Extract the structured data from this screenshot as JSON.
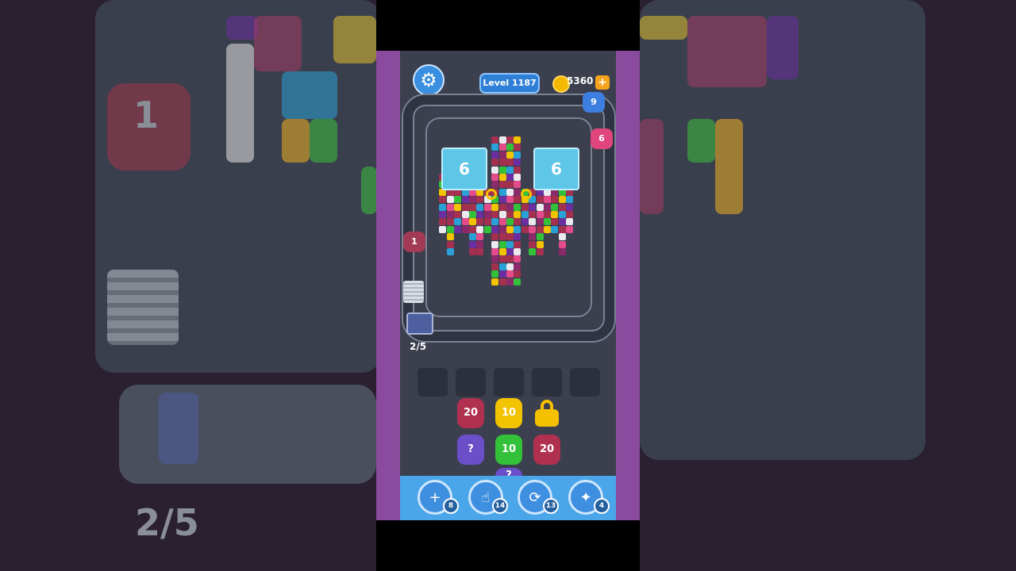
{
  "header": {
    "level_label": "Level 1187",
    "coins": "5360",
    "coin_plus": "+",
    "settings_icon": "gear-icon"
  },
  "board": {
    "ice_left": "6",
    "ice_right": "6",
    "pointer_top": "9",
    "pointer_right": "6",
    "pointer_left": "1",
    "cart_progress": "2/5"
  },
  "queue": {
    "pigs": [
      {
        "value": "20",
        "color": "#b0304f"
      },
      {
        "value": "10",
        "color": "#f2c300"
      },
      {
        "value": "?",
        "color": "#6a4fc8"
      },
      {
        "value": "10",
        "color": "#33c13a"
      },
      {
        "value": "20",
        "color": "#b0304f"
      },
      {
        "value": "?",
        "color": "#6a4fc8"
      }
    ]
  },
  "tools": [
    {
      "icon": "add-slot-icon",
      "count": "8"
    },
    {
      "icon": "hand-icon",
      "count": "14"
    },
    {
      "icon": "shuffle-icon",
      "count": "13"
    },
    {
      "icon": "magic-icon",
      "count": "4"
    }
  ],
  "background": {
    "left_pointer_value": "1",
    "left_counter": "2/5"
  }
}
